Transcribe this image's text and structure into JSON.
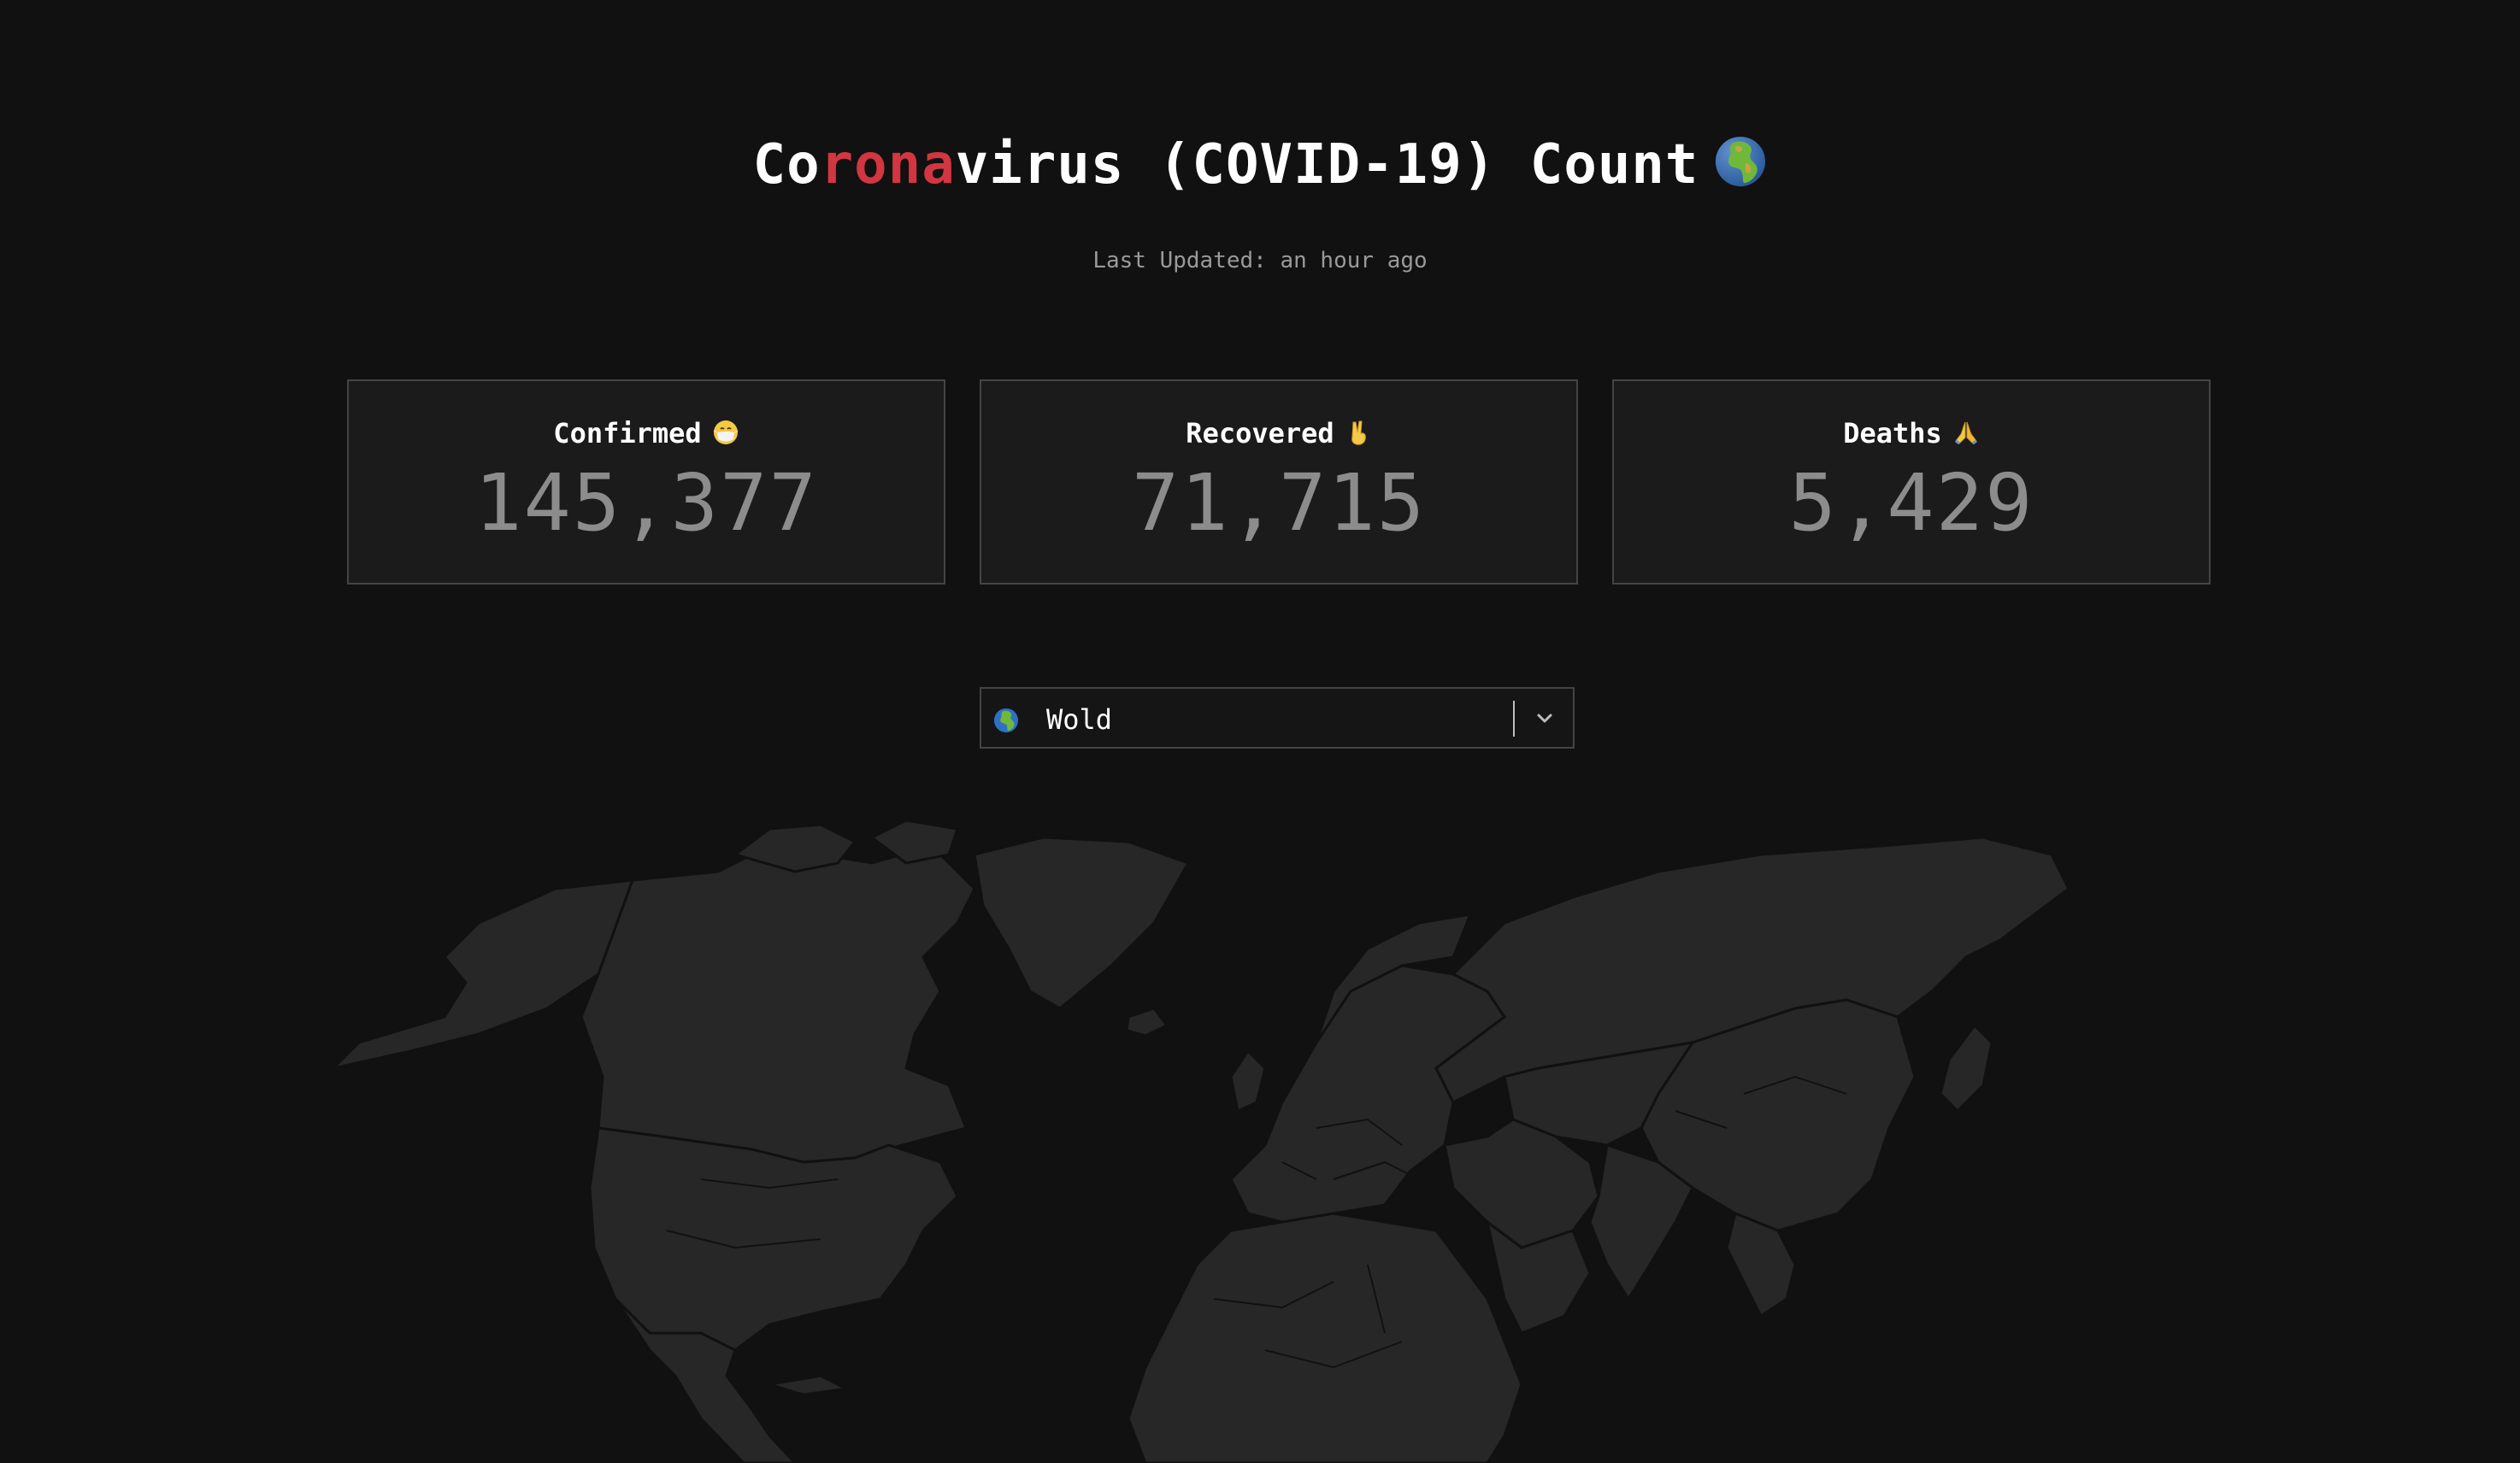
{
  "header": {
    "title_prefix": "Co",
    "title_accent": "rona",
    "title_suffix": "virus (COVID-19) Count",
    "title_icon": "globe-africa-europe-icon"
  },
  "status": {
    "last_updated": "Last Updated: an hour ago"
  },
  "stats": [
    {
      "label": "Confirmed",
      "icon": "face-with-medical-mask-icon",
      "value": "145,377"
    },
    {
      "label": "Recovered",
      "icon": "victory-hand-icon",
      "value": "71,715"
    },
    {
      "label": "Deaths",
      "icon": "folded-hands-icon",
      "value": "5,429"
    }
  ],
  "region_select": {
    "icon": "globe-icon",
    "value": "Wold"
  },
  "colors": {
    "background": "#111111",
    "accent": "#d23741",
    "card_background": "#1b1b1b",
    "card_border": "#444444",
    "stat_value": "#8c8c8c",
    "map_land": "#272727",
    "map_border": "#111111"
  }
}
